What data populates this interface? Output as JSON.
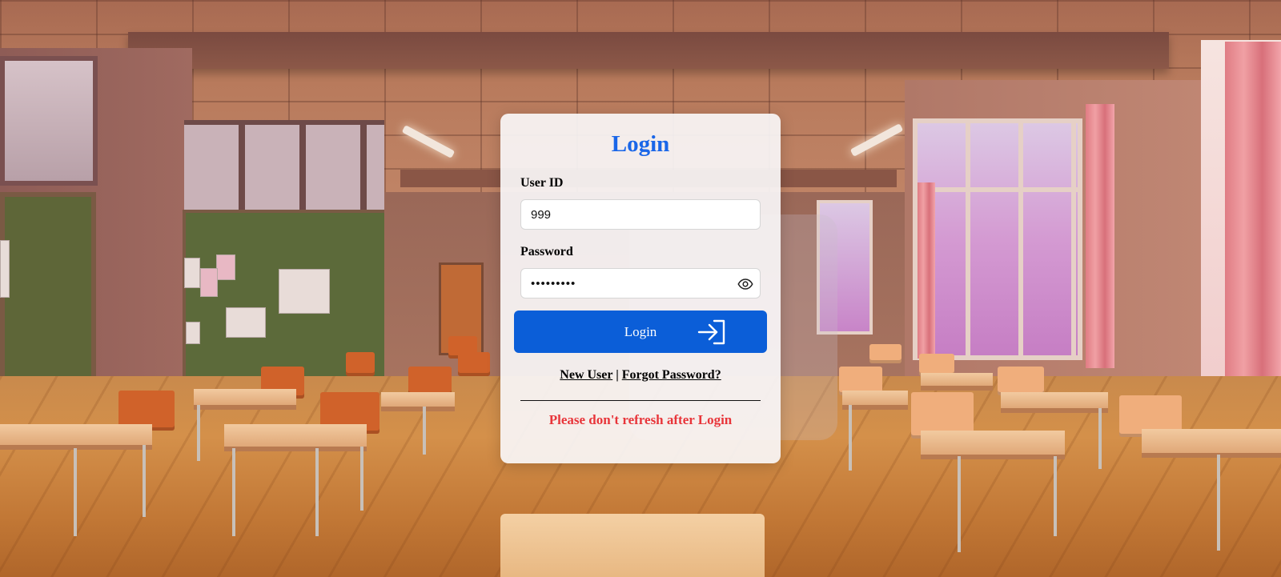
{
  "login": {
    "title": "Login",
    "user_id": {
      "label": "User ID",
      "value": "999"
    },
    "password": {
      "label": "Password",
      "masked_value": "•••••••••"
    },
    "submit_label": "Login",
    "links": {
      "new_user": "New User",
      "separator": "|",
      "forgot_password": "Forgot Password?"
    },
    "warning": "Please don't refresh after Login"
  },
  "colors": {
    "title": "#1a66e8",
    "button": "#0b5ed8",
    "warning": "#e8353a"
  },
  "icons": {
    "password_toggle": "eye-icon",
    "submit": "login-arrow-icon"
  }
}
